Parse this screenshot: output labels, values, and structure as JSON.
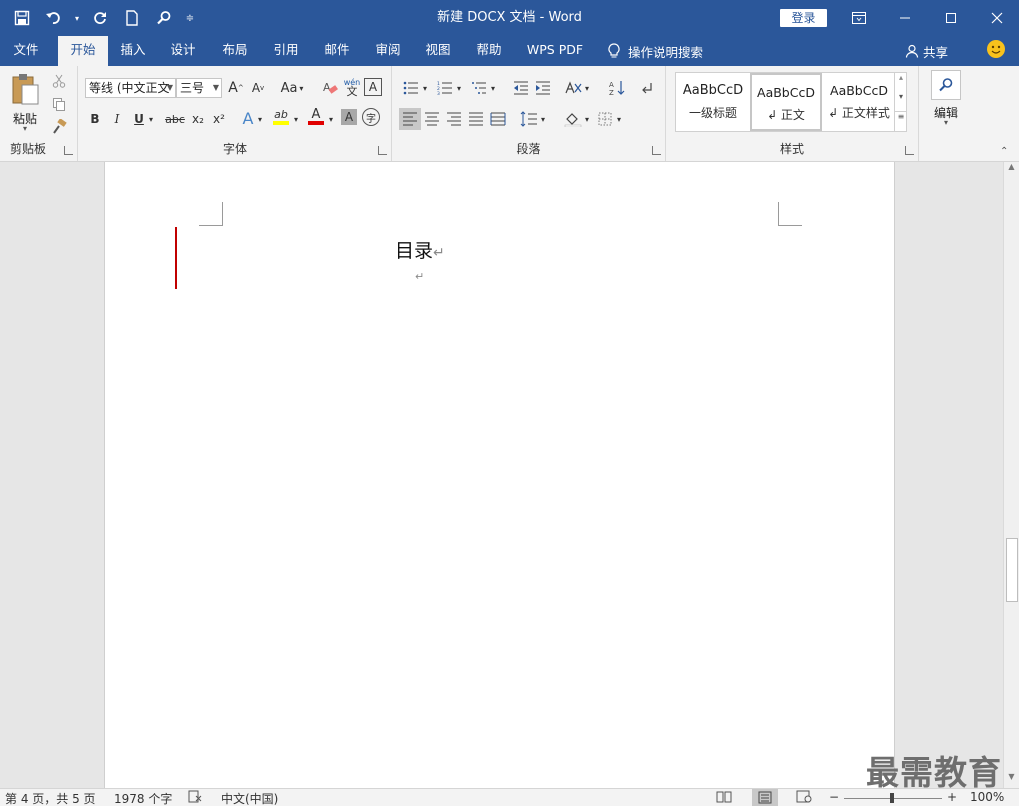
{
  "window": {
    "title": "新建 DOCX 文档  -  Word",
    "login_label": "登录"
  },
  "tabs": [
    {
      "label": "文件"
    },
    {
      "label": "开始",
      "active": true
    },
    {
      "label": "插入"
    },
    {
      "label": "设计"
    },
    {
      "label": "布局"
    },
    {
      "label": "引用"
    },
    {
      "label": "邮件"
    },
    {
      "label": "审阅"
    },
    {
      "label": "视图"
    },
    {
      "label": "帮助"
    },
    {
      "label": "WPS PDF"
    }
  ],
  "tellme": "操作说明搜索",
  "share": "共享",
  "ribbon": {
    "clipboard": {
      "paste_label": "粘贴",
      "group_label": "剪贴板"
    },
    "font": {
      "font_name": "等线 (中文正文",
      "font_size": "三号",
      "grow_label": "A",
      "shrink_label": "A",
      "case_label": "Aa",
      "pinyin_label": "wén",
      "pinyin_char": "文",
      "border_char": "A",
      "bold": "B",
      "italic": "I",
      "underline": "U",
      "strike": "abc",
      "subscript": "x₂",
      "superscript": "x²",
      "effect": "A",
      "highlight": "ab",
      "color": "A",
      "shade": "A",
      "enclose": "字",
      "group_label": "字体"
    },
    "paragraph": {
      "group_label": "段落"
    },
    "styles": {
      "items": [
        {
          "sample": "AaBbCcD",
          "name": "一级标题"
        },
        {
          "sample": "AaBbCcD",
          "name": "↲ 正文"
        },
        {
          "sample": "AaBbCcD",
          "name": "↲ 正文样式"
        }
      ],
      "group_label": "样式"
    },
    "editing": {
      "label": "编辑"
    }
  },
  "document": {
    "heading": "目录",
    "para_mark": "↵",
    "empty_para_mark": "↵"
  },
  "watermark": "最需教育",
  "status": {
    "page": "第 4 页，共 5 页",
    "words": "1978 个字",
    "language": "中文(中国)",
    "zoom_minus": "−",
    "zoom_plus": "+",
    "zoom": "100%"
  },
  "colors": {
    "accent": "#2b579a",
    "font_color_bar": "#e00000",
    "highlight_bar": "#ffff00",
    "cursor_line": "#c00000"
  }
}
